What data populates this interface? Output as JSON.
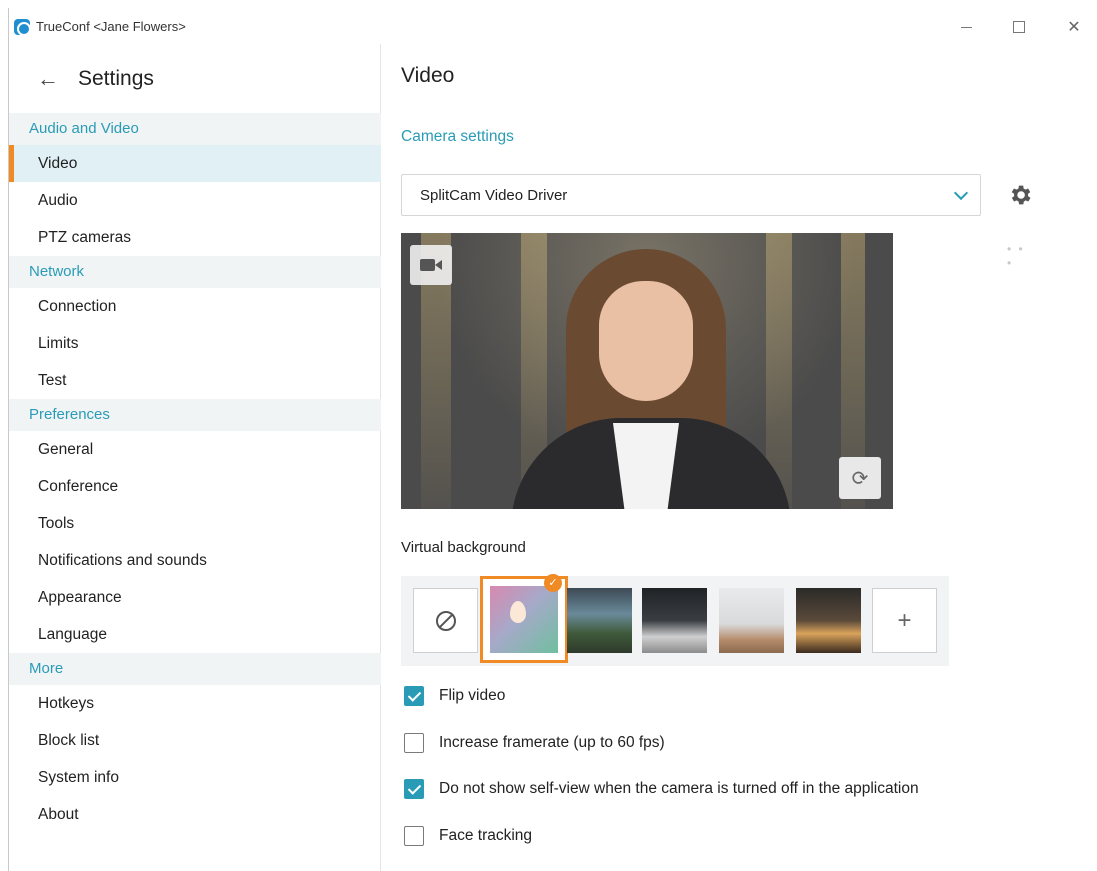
{
  "window": {
    "title": "TrueConf <Jane Flowers>"
  },
  "sidebar": {
    "title": "Settings",
    "groups": [
      {
        "label": "Audio and Video",
        "items": [
          "Video",
          "Audio",
          "PTZ cameras"
        ]
      },
      {
        "label": "Network",
        "items": [
          "Connection",
          "Limits",
          "Test"
        ]
      },
      {
        "label": "Preferences",
        "items": [
          "General",
          "Conference",
          "Tools",
          "Notifications and sounds",
          "Appearance",
          "Language"
        ]
      },
      {
        "label": "More",
        "items": [
          "Hotkeys",
          "Block list",
          "System info",
          "About"
        ]
      }
    ],
    "active_item": "Video"
  },
  "main": {
    "title": "Video",
    "camera_section": "Camera settings",
    "camera_device": "SplitCam Video Driver",
    "virtual_background_label": "Virtual background",
    "selected_background": "blur",
    "options": [
      {
        "label": "Flip video",
        "checked": true
      },
      {
        "label": "Increase framerate (up to 60 fps)",
        "checked": false
      },
      {
        "label": "Do not show self-view when the camera is turned off in the application",
        "checked": true
      },
      {
        "label": "Face tracking",
        "checked": false
      }
    ]
  },
  "icons": {
    "back": "arrow-left-icon",
    "settings": "gear-icon",
    "more": "more-dots-icon",
    "camera": "video-camera-icon",
    "rotate": "rotate-icon",
    "none": "no-background-icon",
    "add": "plus-icon"
  },
  "colors": {
    "accent": "#2a9bb6",
    "highlight": "#f08a24",
    "active_bg": "#e1f0f5"
  }
}
